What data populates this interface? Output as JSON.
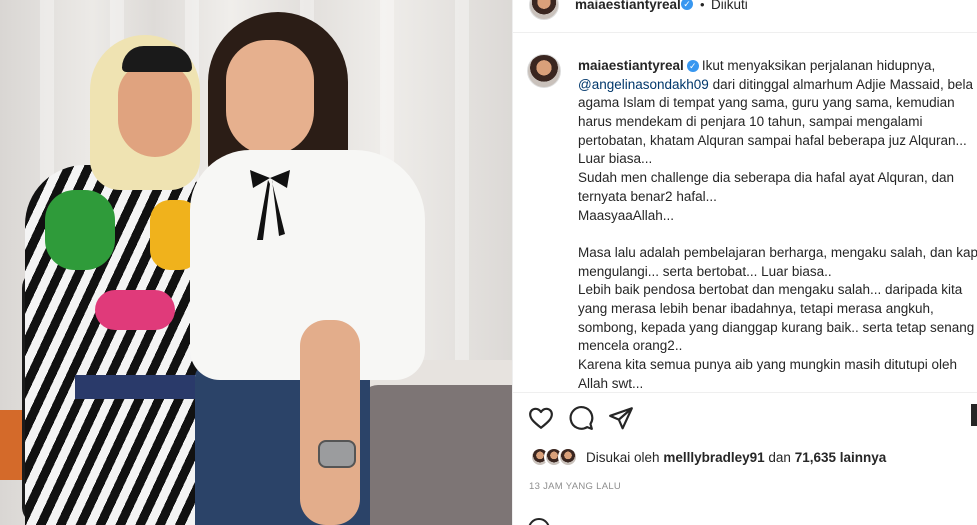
{
  "header": {
    "username": "maiaestiantyreal",
    "separator": "•",
    "follow_status": "Diikuti"
  },
  "caption": {
    "username": "maiaestiantyreal",
    "lines": [
      "Ikut menyaksikan perjalanan hidupnya,",
      "dari ditinggal almarhum Adjie Massaid, bela",
      "agama Islam di tempat yang sama, guru yang sama, kemudian",
      "harus mendekam di penjara 10 tahun, sampai mengalami",
      "pertobatan, khatam Alquran sampai hafal beberapa juz Alquran...",
      "Luar biasa...",
      "Sudah men challenge dia seberapa dia hafal ayat Alquran, dan",
      "ternyata benar2 hafal...",
      "MaasyaaAllah...",
      "",
      "Masa lalu adalah pembelajaran berharga, mengaku salah, dan kap",
      "mengulangi... serta bertobat... Luar biasa..",
      "Lebih baik pendosa bertobat dan mengaku salah... daripada kita",
      "yang merasa lebih benar ibadahnya, tetapi merasa angkuh,",
      "sombong, kepada yang dianggap kurang baik.. serta tetap senang",
      "mencela orang2..",
      "Karena kita semua punya aib yang mungkin masih ditutupi oleh",
      "Allah swt..."
    ],
    "mention": "@angelinasondakh09"
  },
  "likes": {
    "prefix": "Disukai oleh",
    "top_liker": "melllybradley91",
    "connector": "dan",
    "others": "71,635 lainnya"
  },
  "timestamp": "13 JAM YANG LALU",
  "icons": {
    "like": "heart-icon",
    "comment": "comment-icon",
    "share": "share-icon",
    "save": "bookmark-icon",
    "verified": "verified-badge-icon"
  },
  "colors": {
    "verified": "#3897f0",
    "mention": "#00376b",
    "text": "#262626",
    "muted": "#8e8e8e"
  }
}
